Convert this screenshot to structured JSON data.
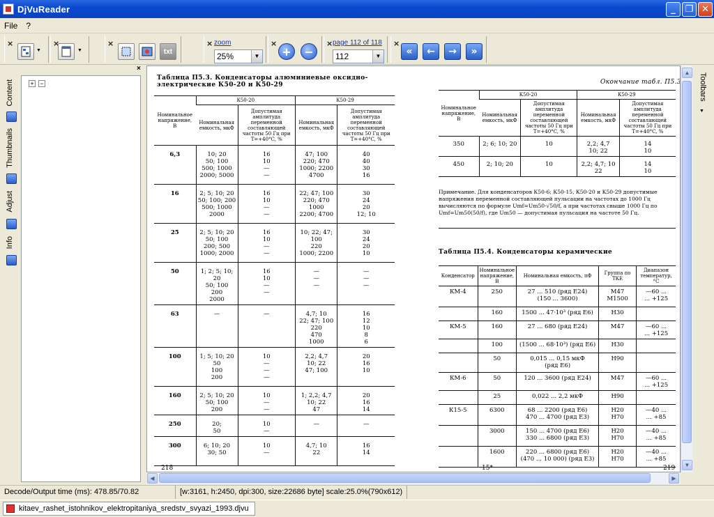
{
  "window": {
    "title": "DjVuReader",
    "controls": {
      "min": "_",
      "max": "❐",
      "close": "✕"
    }
  },
  "menu": [
    "File",
    "?"
  ],
  "toolbar": {
    "zoom_label": "zoom",
    "zoom_value": "25%",
    "page_label": "page 112 of 118",
    "page_value": "112",
    "txt_label": "txt"
  },
  "left_tabs": [
    "Content",
    "Thumbnails",
    "Adjust",
    "Info"
  ],
  "right_tabs": [
    "Toolbars"
  ],
  "status": {
    "decode": "Decode/Output time (ms): 478.85/70.82",
    "info": "[w:3161, h:2450, dpi:300, size:22686 byte] scale:25.0%(790x612)"
  },
  "file_tab": "kitaev_rashet_istohnikov_elektropitaniya_sredstv_svyazi_1993.djvu",
  "page_left": {
    "caption": "Таблица П5.3. Конденсаторы алюминиевые оксидно-электрические К50-20 и К50-29",
    "group1": "К50-20",
    "group2": "К50-29",
    "headers": [
      "Номинальное напряжение, В",
      "Номинальная емкость, мкФ",
      "Допустимая амплитуда переменной составляющей частоты 50 Гц при T=+40°C, %",
      "Номинальная емкость, мкФ",
      "Допустимая амплитуда переменной составляющей частоты 50 Гц при T=+40°C, %"
    ],
    "rows": [
      [
        "6,3",
        "10; 20\n50; 100\n500; 1000\n2000; 5000",
        "16\n10\n—\n—",
        "47; 100\n220; 470\n1000; 2200\n4700",
        "40\n40\n30\n16"
      ],
      [
        "16",
        "2; 5; 10; 20\n50; 100; 200\n500; 1000\n2000",
        "16\n10\n—\n—",
        "22; 47; 100\n220; 470\n1000\n2200; 4700",
        "30\n24\n20\n12; 10"
      ],
      [
        "25",
        "2; 5; 10; 20\n50; 100\n200; 500\n1000; 2000",
        "16\n10\n—\n—",
        "10; 22; 47;\n100\n220\n1000; 2200",
        "30\n24\n20\n10"
      ],
      [
        "50",
        "1; 2; 5; 10; 20\n50; 100\n200\n2000",
        "16\n10\n—\n—",
        "—\n—\n—",
        "—\n—\n—"
      ],
      [
        "63",
        "—",
        "—",
        "4,7; 10\n22; 47; 100\n220\n470\n1000",
        "16\n12\n10\n8\n6"
      ],
      [
        "100",
        "1; 5; 10; 20\n50\n100\n200",
        "10\n—\n—\n—",
        "2,2; 4,7\n10; 22\n47; 100",
        "20\n16\n10"
      ],
      [
        "160",
        "2; 5; 10; 20\n50; 100\n200",
        "10\n—\n—",
        "1; 2,2; 4,7\n10; 22\n47",
        "20\n16\n14"
      ],
      [
        "250",
        "20;\n50",
        "10\n—",
        "—",
        "—"
      ],
      [
        "300",
        "6; 10; 20\n30; 50",
        "10\n—",
        "4,7; 10\n22",
        "16\n14"
      ]
    ],
    "page_number": "218"
  },
  "page_right": {
    "cont_caption": "Окончание табл. П5.3",
    "group1": "К50-20",
    "group2": "К50-29",
    "headers": [
      "Номинальное напряжение, В",
      "Номинальная емкость, мкФ",
      "Допустимая амплитуда переменной составляющей частоты 50 Гц при T=+40°C, %",
      "Номинальная емкость, мкФ",
      "Допустимая амплитуда переменной составляющей частоты 50 Гц при T=+40°C, %"
    ],
    "rows": [
      [
        "350",
        "2; 6; 10; 20",
        "10",
        "2,2; 4,7\n10; 22",
        "14\n10"
      ],
      [
        "450",
        "2; 10; 20",
        "10",
        "2,2; 4,7; 10\n22",
        "14\n10"
      ]
    ],
    "note": "Примечание. Для конденсаторов К50-6; К50-15, К50-20 и К50-29 допустимые напряжения переменной составляющей пульсации на частотах до 1000 Гц вычисляются по формуле Umf=Um50·√50/f, а при частотах свыше 1000 Гц по Umf=Um50(50/f), где Um50 — допустимая пульсация на частоте 50 Гц.",
    "caption2": "Таблица П5.4. Конденсаторы керамические",
    "headers2": [
      "Конденсатор",
      "Номинальное напряжение, В",
      "Номинальная емкость, пФ",
      "Группа по ТКЕ",
      "Диапазон температур, °С"
    ],
    "rows2": [
      [
        "КМ-4",
        "250",
        "27 ... 510 (ряд Е24)\n(150 ... 3600)",
        "М47\nМ1500",
        "—60 ...\n... +125"
      ],
      [
        "",
        "160",
        "1500 ... 47·10³ (ряд Е6)",
        "Н30",
        ""
      ],
      [
        "КМ-5",
        "160",
        "27 ... 680 (ряд Е24)",
        "М47",
        "—60 ...\n... +125"
      ],
      [
        "",
        "100",
        "(1500 ... 68·10³) (ряд Е6)",
        "Н30",
        ""
      ],
      [
        "",
        "50",
        "0,015 ... 0,15 мкФ\n(ряд Е6)",
        "Н90",
        ""
      ],
      [
        "КМ-6",
        "50",
        "120 ... 3600 (ряд Е24)",
        "М47",
        "—60 ...\n... +125"
      ],
      [
        "",
        "25",
        "0,022 ... 2,2 мкФ",
        "Н90",
        ""
      ],
      [
        "К15-5",
        "6300",
        "68 ... 2200 (ряд Е6)\n470 ... 4700 (ряд Е3)",
        "Н20\nН70",
        "—40 ...\n... +85"
      ],
      [
        "",
        "3000",
        "150 ... 4700 (ряд Е6)\n330 ... 6800 (ряд Е3)",
        "Н20\nН70",
        "—40 ...\n... +85"
      ],
      [
        "",
        "1600",
        "220 ... 6800 (ряд Е6)\n(470 ... 10 000) (ряд Е3)",
        "Н20\nН70",
        "—40 ...\n... +85"
      ]
    ],
    "footer_left": "15*",
    "page_number": "219"
  }
}
